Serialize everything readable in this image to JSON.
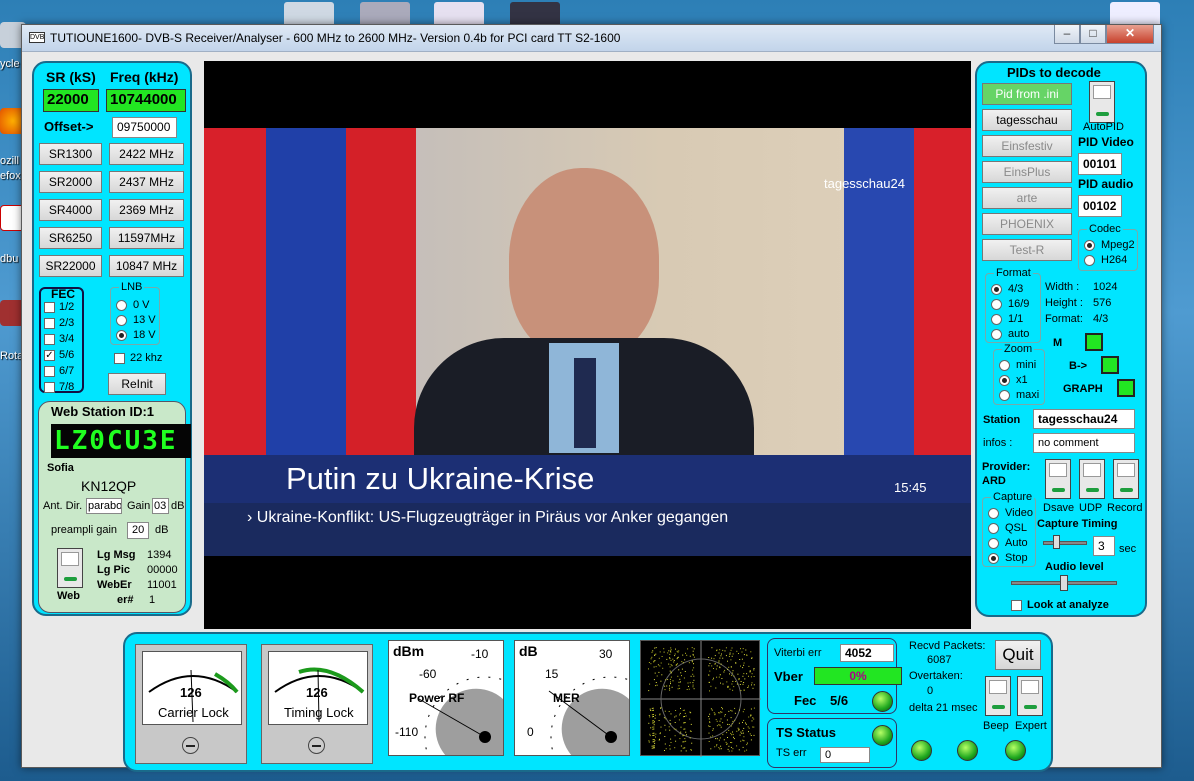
{
  "desktop": {
    "labels": [
      "ycle",
      "ozill",
      "efox",
      "dbu",
      "Rota"
    ]
  },
  "window": {
    "title": "TUTIOUNE1600- DVB-S Receiver/Analyser - 600 MHz to 2600 MHz- Version 0.4b for PCI card TT S2-1600",
    "app_icon": "DVB",
    "min": "–",
    "max": "□",
    "close": "✕"
  },
  "left": {
    "sr_label": "SR (kS)",
    "freq_label": "Freq (kHz)",
    "sr_value": "22000",
    "freq_value": "10744000",
    "offset_label": "Offset->",
    "offset_value": "09750000",
    "sr_buttons": [
      "SR1300",
      "SR2000",
      "SR4000",
      "SR6250",
      "SR22000"
    ],
    "freq_buttons": [
      "2422 MHz",
      "2437 MHz",
      "2369 MHz",
      "11597MHz",
      "10847 MHz"
    ],
    "fec_title": "FEC",
    "fec_items": [
      "1/2",
      "2/3",
      "3/4",
      "5/6",
      "6/7",
      "7/8"
    ],
    "fec_checked_mark": "✓",
    "lnb_title": "LNB",
    "lnb_items": [
      "0 V",
      "13 V",
      "18 V"
    ],
    "khz_label": "22 khz",
    "reinit": "ReInit"
  },
  "web": {
    "title": "Web Station ID:1",
    "callsign": "LZ0CU3E",
    "city": "Sofia",
    "locator": "KN12QP",
    "ant_label": "Ant. Dir.",
    "ant_value": "parabo",
    "gain_label": "Gain",
    "gain_value": "03",
    "gain_unit": "dB",
    "preamp_label": "preampli gain",
    "preamp_value": "20",
    "preamp_unit": "dB",
    "web_label": "Web",
    "stats": [
      {
        "k": "Lg Msg",
        "v": "1394"
      },
      {
        "k": "Lg Pic",
        "v": "00000"
      },
      {
        "k": "WebEr",
        "v": "11001"
      },
      {
        "k": "er#",
        "v": "1"
      }
    ]
  },
  "video": {
    "logo": "tagesschau24",
    "headline": "Putin zu Ukraine-Krise",
    "time": "15:45",
    "ticker": "› Ukraine-Konflikt: US-Flugzeugträger in Piräus vor Anker gegangen"
  },
  "right": {
    "title": "PIDs to decode",
    "pid_buttons": [
      "Pid from .ini",
      "tagesschau",
      "Einsfestiv",
      "EinsPlus",
      "arte",
      "PHOENIX",
      "Test-R"
    ],
    "autopid": "AutoPID",
    "pid_video_label": "PID Video",
    "pid_video": "00101",
    "pid_audio_label": "PID audio",
    "pid_audio": "00102",
    "codec_title": "Codec",
    "codec_items": [
      "Mpeg2",
      "H264"
    ],
    "format_title": "Format",
    "format_items": [
      "4/3",
      "16/9",
      "1/1",
      "auto"
    ],
    "width_label": "Width :",
    "width": "1024",
    "height_label": "Height :",
    "height": "576",
    "fmt_label": "Format:",
    "fmt": "4/3",
    "zoom_title": "Zoom",
    "zoom_items": [
      "mini",
      "x1",
      "maxi"
    ],
    "m_label": "M",
    "b_label": "B->",
    "graph_label": "GRAPH",
    "station_label": "Station",
    "station": "tagesschau24",
    "infos_label": "infos :",
    "infos": "no comment",
    "provider_label": "Provider:",
    "provider": "ARD",
    "dsave": "Dsave",
    "udp": "UDP",
    "record": "Record",
    "capture_title": "Capture",
    "capture_items": [
      "Video",
      "QSL",
      "Auto",
      "Stop"
    ],
    "timing_label": "Capture Timing",
    "timing_value": "3",
    "timing_unit": "sec",
    "audio_label": "Audio level",
    "look_label": "Look at analyze"
  },
  "bottom": {
    "carrier_value": "126",
    "carrier_label": "Carrier Lock",
    "timing_value": "126",
    "timing_label": "Timing Lock",
    "power": {
      "unit": "dBm",
      "label": "Power RF",
      "ticks": [
        "-60",
        "-10",
        "-110"
      ]
    },
    "mer": {
      "unit": "dB",
      "label": "MER",
      "ticks": [
        "15",
        "30",
        "0"
      ]
    },
    "viterbi_label": "Viterbi err",
    "viterbi_value": "4052",
    "vber_label": "Vber",
    "vber_value": "0%",
    "fec_label": "Fec",
    "fec_value": "5/6",
    "ts_label": "TS Status",
    "ts_err_label": "TS err",
    "ts_err_value": "0",
    "packets_label": "Recvd Packets:",
    "packets": "6087",
    "overtaken_label": "Overtaken:",
    "overtaken": "0",
    "delta": "delta 21 msec",
    "quit": "Quit",
    "beep": "Beep",
    "expert": "Expert"
  }
}
